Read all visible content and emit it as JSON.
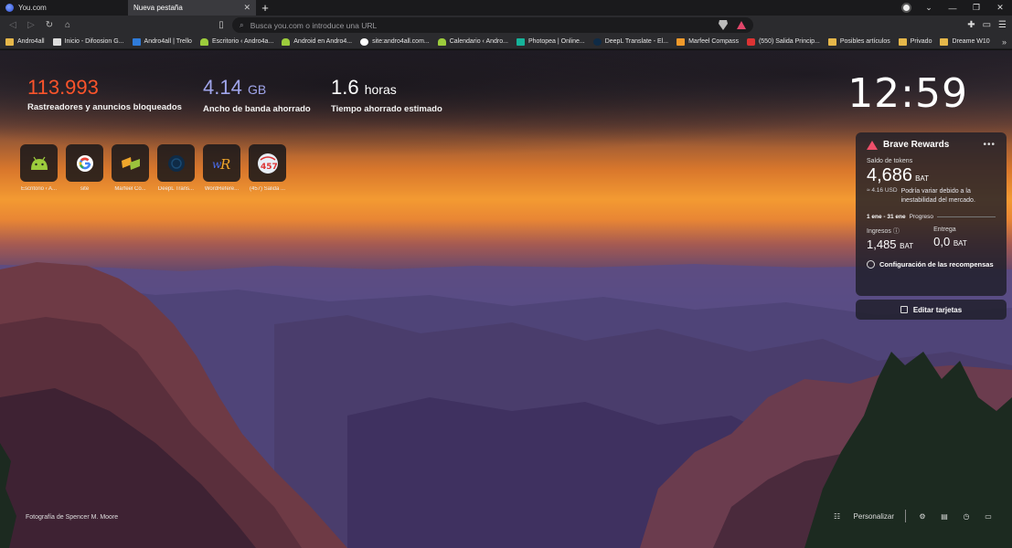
{
  "tabs": [
    {
      "title": "You.com",
      "active": false
    },
    {
      "title": "Nueva pestaña",
      "active": true
    }
  ],
  "toolbar": {
    "omnibox_placeholder": "Busca you.com o introduce una URL"
  },
  "bookmarks": [
    {
      "label": "Andro4all",
      "icon": "folder"
    },
    {
      "label": "Inicio - Difoosion G...",
      "icon": "doc"
    },
    {
      "label": "Andro4all | Trello",
      "icon": "trello"
    },
    {
      "label": "Escritorio ‹ Andro4a...",
      "icon": "android"
    },
    {
      "label": "Android en Andro4...",
      "icon": "android"
    },
    {
      "label": "site:andro4all.com...",
      "icon": "google"
    },
    {
      "label": "Calendario ‹ Andro...",
      "icon": "android"
    },
    {
      "label": "Photopea | Online...",
      "icon": "photopea"
    },
    {
      "label": "DeepL Translate - El...",
      "icon": "deepl"
    },
    {
      "label": "Marfeel Compass",
      "icon": "marfeel"
    },
    {
      "label": "(550) Salida Princip...",
      "icon": "yt"
    },
    {
      "label": "Posibles artículos",
      "icon": "folder"
    },
    {
      "label": "Privado",
      "icon": "folder"
    },
    {
      "label": "Dreame W10",
      "icon": "folder"
    }
  ],
  "stats": {
    "trackers": {
      "value": "113.993",
      "label": "Rastreadores y anuncios bloqueados"
    },
    "bandwidth": {
      "value": "4.14",
      "unit": "GB",
      "label": "Ancho de banda ahorrado"
    },
    "time": {
      "value": "1.6",
      "unit": "horas",
      "label": "Tiempo ahorrado estimado"
    }
  },
  "clock": "12:59",
  "top_sites": [
    {
      "name": "Escritorio ‹ A...",
      "icon": "android-icon"
    },
    {
      "name": "site",
      "icon": "google-icon"
    },
    {
      "name": "Marfeel Co...",
      "icon": "marfeel-icon"
    },
    {
      "name": "DeepL Trans...",
      "icon": "deepl-icon"
    },
    {
      "name": "WordRefere...",
      "icon": "wordreference-icon"
    },
    {
      "name": "(457) Salida ...",
      "icon": "youtube-icon"
    }
  ],
  "rewards": {
    "title": "Brave Rewards",
    "balance_label": "Saldo de tokens",
    "balance_value": "4,686",
    "balance_unit": "BAT",
    "usd": "≈ 4.16 USD",
    "note": "Podría variar debido a la inestabilidad del mercado.",
    "range": "1 ene - 31 ene",
    "progress_label": "Progreso",
    "income_label": "Ingresos",
    "income_value": "1,485",
    "income_unit": "BAT",
    "delivery_label": "Entrega",
    "delivery_value": "0,0",
    "delivery_unit": "BAT",
    "config_label": "Configuración de las recompensas"
  },
  "edit_cards": "Editar tarjetas",
  "photo_credit": "Fotografía de Spencer M. Moore",
  "customize": "Personalizar",
  "colors": {
    "trackers": "#fb542b",
    "bandwidth": "#a0a5eb",
    "brave": "#ef4f6a"
  }
}
